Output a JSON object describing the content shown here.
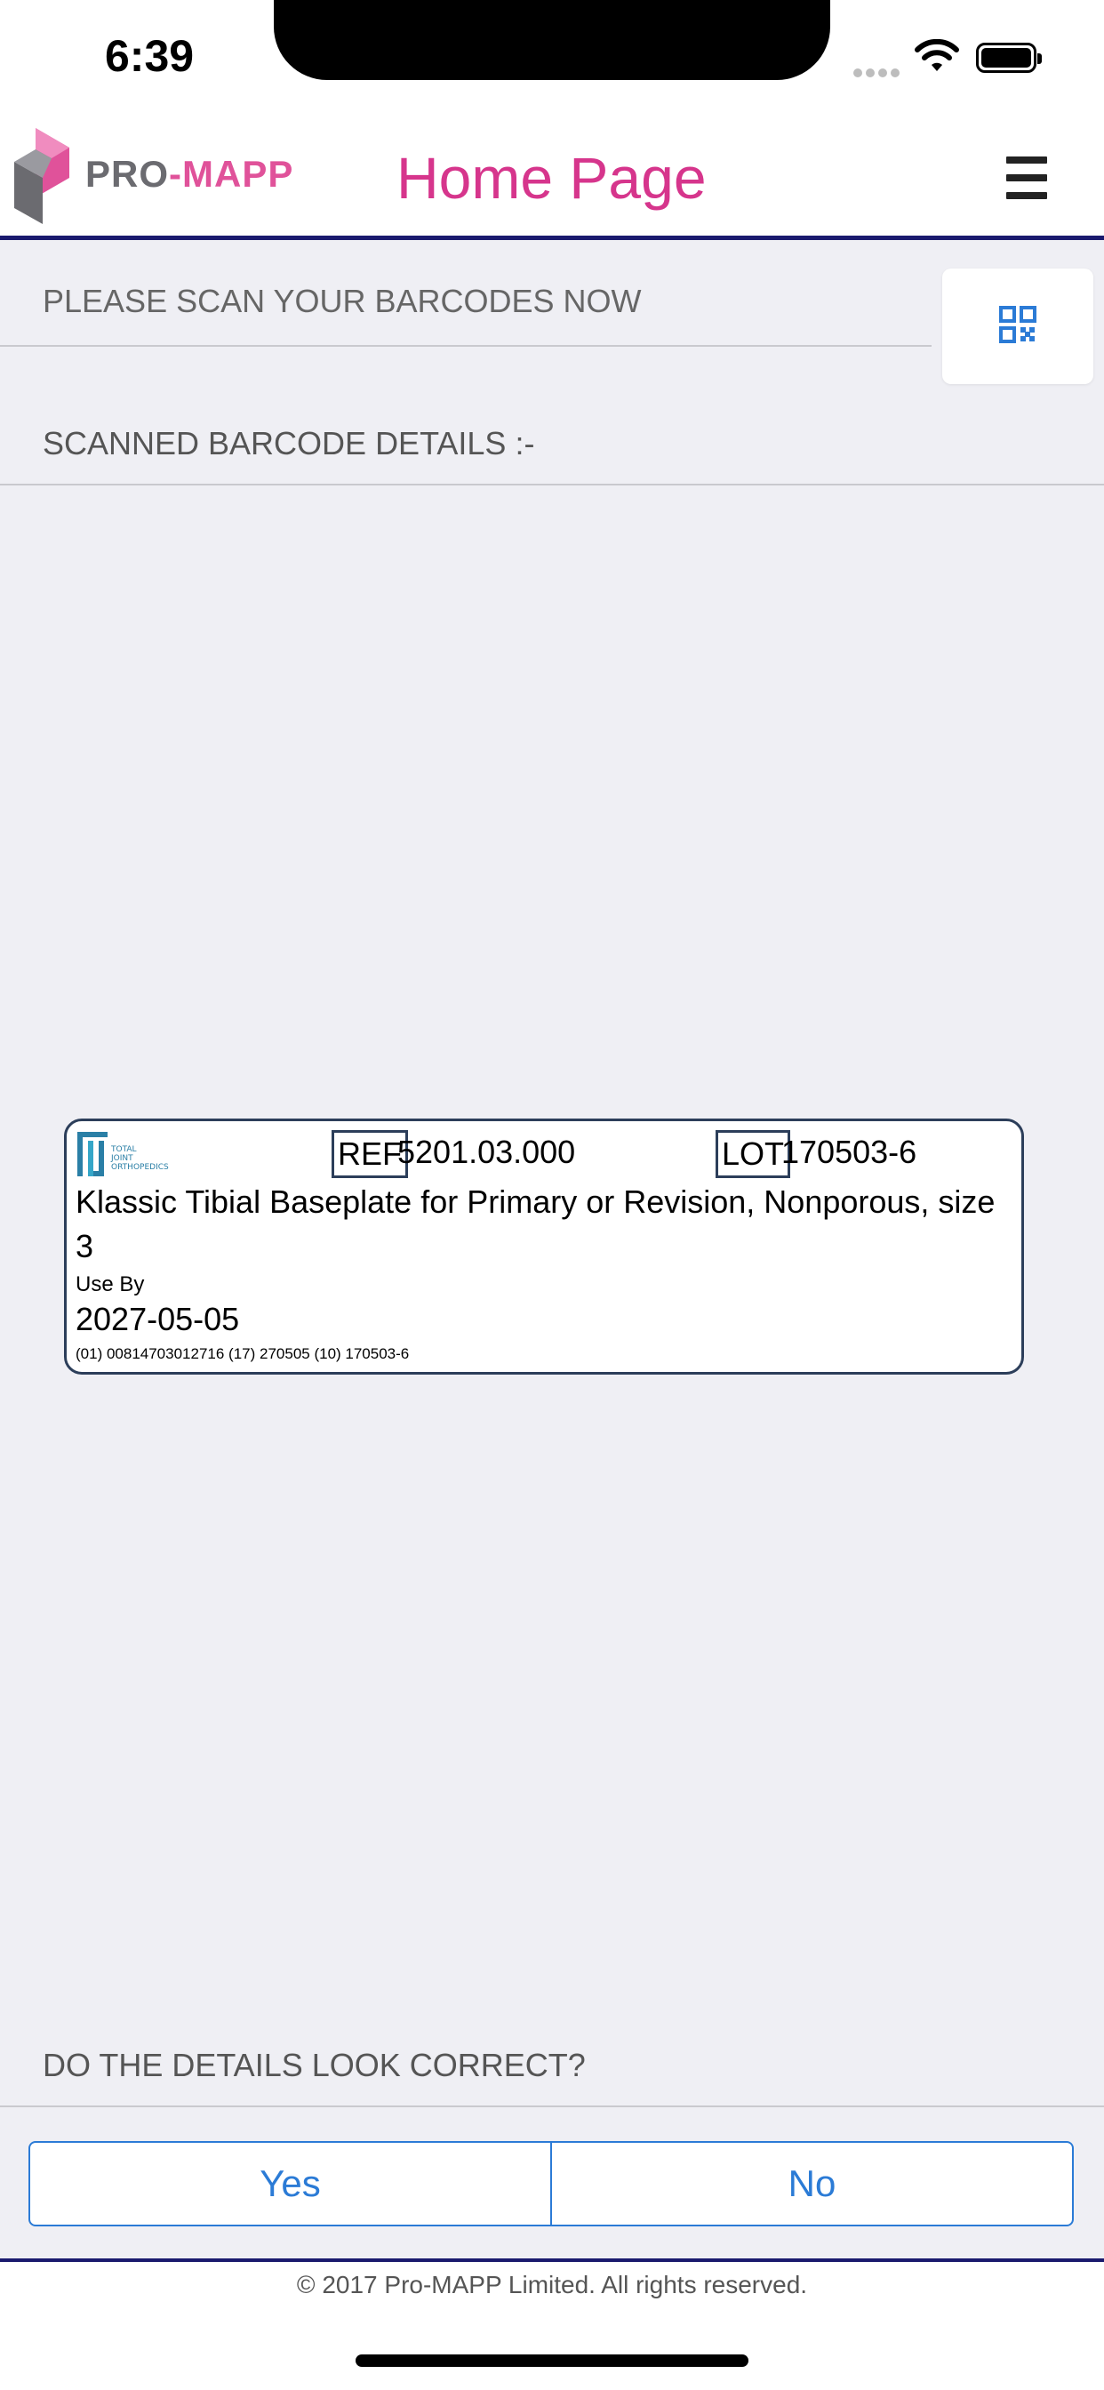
{
  "status_bar": {
    "time": "6:39"
  },
  "header": {
    "logo_pro": "PRO",
    "logo_dash": "-",
    "logo_mapp": "MAPP",
    "title": "Home Page"
  },
  "scan": {
    "placeholder": "PLEASE SCAN YOUR BARCODES NOW",
    "value": ""
  },
  "details": {
    "heading": "SCANNED BARCODE DETAILS :-"
  },
  "label": {
    "company_lines": [
      "TOTAL",
      "JOINT",
      "ORTHOPEDICS"
    ],
    "ref_tag": "REF",
    "ref_value": "5201.03.000",
    "lot_tag": "LOT",
    "lot_value": "170503-6",
    "description": "Klassic Tibial Baseplate for Primary or Revision, Nonporous, size 3",
    "use_by_label": "Use By",
    "use_by_date": "2027-05-05",
    "gs1_string": "(01) 00814703012716 (17) 270505 (10) 170503-6"
  },
  "confirm": {
    "question": "DO THE DETAILS LOOK CORRECT?",
    "yes_label": "Yes",
    "no_label": "No"
  },
  "footer": {
    "copyright": "© 2017 Pro-MAPP Limited. All rights reserved."
  },
  "colors": {
    "brand_pink": "#d6358c",
    "brand_navy": "#1a1a6e",
    "button_blue": "#2b7bd6",
    "background": "#efeff4"
  },
  "icons": [
    "wifi-icon",
    "battery-icon",
    "promapp-logo-icon",
    "menu-icon",
    "qr-code-icon",
    "tj-logo-icon"
  ]
}
